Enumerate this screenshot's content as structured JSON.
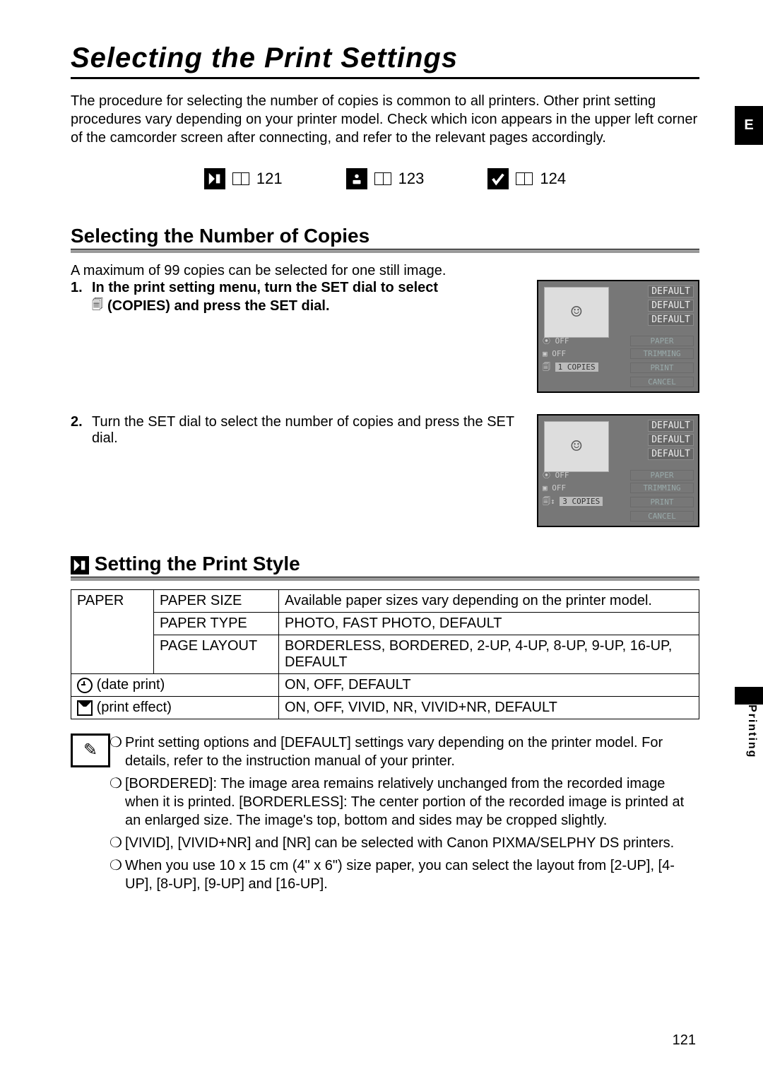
{
  "heading": "Selecting the Print Settings",
  "intro": "The procedure for selecting the number of copies is common to all printers. Other print setting procedures vary depending on your printer model. Check which icon appears in the upper left corner of the camcorder screen after connecting, and refer to the relevant pages accordingly.",
  "edge_tab": "E",
  "side_label": "Printing",
  "page_number": "121",
  "refs": [
    "121",
    "123",
    "124"
  ],
  "sub1_title": "Selecting the Number of Copies",
  "sub1_note": "A maximum of 99 copies can be selected for one still image.",
  "steps": [
    {
      "num": "1.",
      "bold_a": "In the print setting menu, turn the SET dial to select",
      "bold_b": "(COPIES) and press the SET dial."
    },
    {
      "num": "2.",
      "bold": "Turn the SET dial to select the number of copies and press the SET dial."
    }
  ],
  "screen1": {
    "defaults": [
      "DEFAULT",
      "DEFAULT",
      "DEFAULT"
    ],
    "rows": [
      {
        "l": "OFF",
        "r": "PAPER"
      },
      {
        "l": "OFF",
        "r": "TRIMMING"
      },
      {
        "l": "",
        "r": "PRINT"
      }
    ],
    "copies_chip": "1 COPIES",
    "cancel": "CANCEL"
  },
  "screen2": {
    "defaults": [
      "DEFAULT",
      "DEFAULT",
      "DEFAULT"
    ],
    "rows": [
      {
        "l": "OFF",
        "r": "PAPER"
      },
      {
        "l": "OFF",
        "r": "TRIMMING"
      },
      {
        "l": "",
        "r": "PRINT"
      }
    ],
    "copies_chip": "3 COPIES",
    "cancel": "CANCEL"
  },
  "sub2_title": "Setting the Print Style",
  "table": {
    "r1": {
      "a": "PAPER",
      "b": "PAPER SIZE",
      "c": "Available paper sizes vary depending on the printer model."
    },
    "r2": {
      "b": "PAPER TYPE",
      "c": "PHOTO, FAST PHOTO, DEFAULT"
    },
    "r3": {
      "b": "PAGE LAYOUT",
      "c": "BORDERLESS, BORDERED, 2-UP, 4-UP, 8-UP, 9-UP, 16-UP, DEFAULT"
    },
    "r4": {
      "a": "(date print)",
      "c": "ON, OFF, DEFAULT"
    },
    "r5": {
      "a": "(print effect)",
      "c": "ON, OFF, VIVID, NR, VIVID+NR, DEFAULT"
    }
  },
  "notes": [
    "Print setting options and [DEFAULT] settings vary depending on the printer model. For details, refer to the instruction manual of your printer.",
    "[BORDERED]: The image area remains relatively unchanged from the recorded image when it is printed. [BORDERLESS]: The center portion of the recorded image is printed at an enlarged size. The image's top, bottom and sides may be cropped slightly.",
    "[VIVID], [VIVID+NR] and [NR] can be selected with Canon PIXMA/SELPHY DS printers.",
    "When you use 10 x 15 cm (4\" x 6\") size paper, you can select the layout from [2-UP], [4-UP], [8-UP], [9-UP] and [16-UP]."
  ],
  "bullet": "❍"
}
